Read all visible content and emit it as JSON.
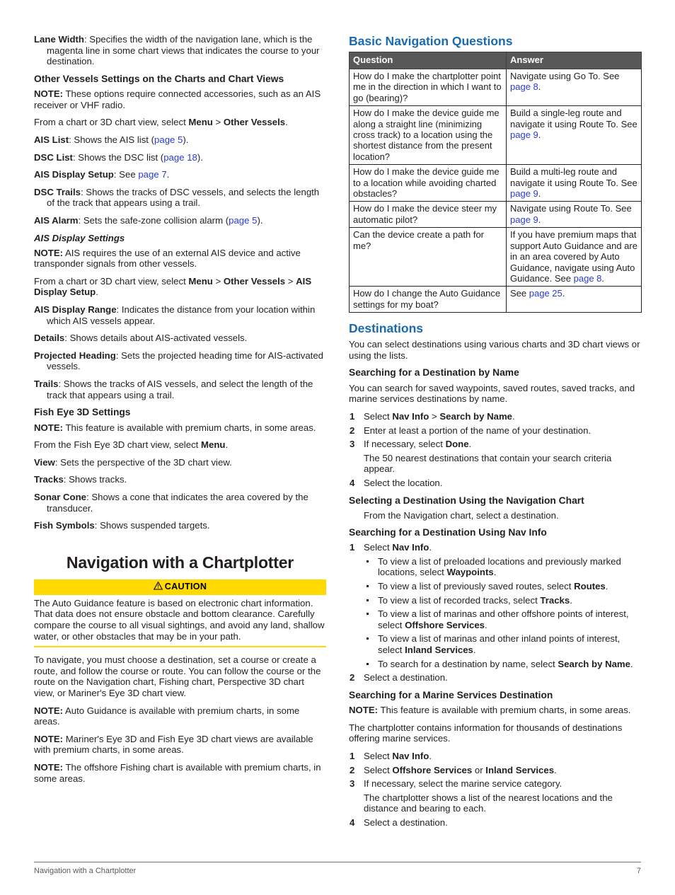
{
  "document": {
    "chapter_title": "Navigation with a Chartplotter",
    "footer_left": "Navigation with a Chartplotter",
    "footer_page": "7",
    "colors": {
      "heading_blue": "#1a6aae",
      "link_blue": "#2a3bd0",
      "caution_yellow": "#ffd900",
      "table_header_gray": "#585858",
      "body_text": "#231f20"
    }
  },
  "left_column": {
    "lane_width": {
      "term": "Lane Width",
      "text": ": Specifies the width of the navigation lane, which is the magenta line in some chart views that indicates the course to your destination."
    },
    "other_vessels": {
      "heading": "Other Vessels Settings on the Charts and Chart Views",
      "note_label": "NOTE:",
      "note_text": " These options require connected accessories, such as an AIS receiver or VHF radio.",
      "path_prefix": "From a chart or 3D chart view, select ",
      "path_menu": "Menu",
      "path_sep": " > ",
      "path_target": "Other Vessels",
      "path_period": ".",
      "items": [
        {
          "term": "AIS List",
          "text": ": Shows the AIS list (",
          "link": "page 5",
          "after": ")."
        },
        {
          "term": "DSC List",
          "text": ": Shows the DSC list (",
          "link": "page 18",
          "after": ")."
        },
        {
          "term": "AIS Display Setup",
          "text": ": See ",
          "link": "page 7",
          "after": "."
        },
        {
          "term": "DSC Trails",
          "text": ": Shows the tracks of DSC vessels, and selects the length of the track that appears using a trail.",
          "link": "",
          "after": ""
        },
        {
          "term": "AIS Alarm",
          "text": ": Sets the safe-zone collision alarm (",
          "link": "page 5",
          "after": ")."
        }
      ]
    },
    "ais_display_settings": {
      "heading": "AIS Display Settings",
      "note_label": "NOTE:",
      "note_text": " AIS requires the use of an external AIS device and active transponder signals from other vessels.",
      "path_prefix": "From a chart or 3D chart view, select ",
      "path_menu": "Menu",
      "path_sep1": " > ",
      "path_mid": "Other Vessels",
      "path_sep2": " > ",
      "path_target": "AIS Display Setup",
      "path_period": ".",
      "items": [
        {
          "term": "AIS Display Range",
          "text": ": Indicates the distance from your location within which AIS vessels appear."
        },
        {
          "term": "Details",
          "text": ": Shows details about AIS-activated vessels."
        },
        {
          "term": "Projected Heading",
          "text": ": Sets the projected heading time for AIS-activated vessels."
        },
        {
          "term": "Trails",
          "text": ": Shows the tracks of AIS vessels, and select the length of the track that appears using a trail."
        }
      ]
    },
    "fish_eye": {
      "heading": "Fish Eye 3D Settings",
      "note_label": "NOTE:",
      "note_text": " This feature is available with premium charts, in some areas.",
      "path_prefix": "From the Fish Eye 3D chart view, select ",
      "path_menu": "Menu",
      "path_period": ".",
      "items": [
        {
          "term": "View",
          "text": ": Sets the perspective of the 3D chart view."
        },
        {
          "term": "Tracks",
          "text": ": Shows tracks."
        },
        {
          "term": "Sonar Cone",
          "text": ": Shows a cone that indicates the area covered by the transducer."
        },
        {
          "term": "Fish Symbols",
          "text": ": Shows suspended targets."
        }
      ]
    },
    "caution": {
      "label": "CAUTION",
      "body": "The Auto Guidance feature is based on electronic chart information. That data does not ensure obstacle and bottom clearance. Carefully compare the course to all visual sightings, and avoid any land, shallow water, or other obstacles that may be in your path."
    },
    "nav_intro": {
      "paragraph": "To navigate, you must choose a destination, set a course or create a route, and follow the course or route. You can follow the course or the route on the Navigation chart, Fishing chart, Perspective 3D chart view, or Mariner's Eye 3D chart view.",
      "notes": [
        {
          "label": "NOTE:",
          "text": " Auto Guidance is available with premium charts, in some areas."
        },
        {
          "label": "NOTE:",
          "text": " Mariner's Eye 3D and Fish Eye 3D chart views are available with premium charts, in some areas."
        },
        {
          "label": "NOTE:",
          "text": " The offshore Fishing chart is available with premium charts, in some areas."
        }
      ]
    }
  },
  "right_column": {
    "basic_nav": {
      "heading": "Basic Navigation Questions",
      "table": {
        "headers": [
          "Question",
          "Answer"
        ],
        "rows": [
          {
            "question": "How do I make the chartplotter point me in the direction in which I want to go (bearing)?",
            "answer_pre": "Navigate using Go To. See ",
            "answer_link": "page 8",
            "answer_post": "."
          },
          {
            "question": "How do I make the device guide me along a straight line (minimizing cross track) to a location using the shortest distance from the present location?",
            "answer_pre": "Build a single-leg route and navigate it using Route To. See ",
            "answer_link": "page 9",
            "answer_post": "."
          },
          {
            "question": "How do I make the device guide me to a location while avoiding charted obstacles?",
            "answer_pre": "Build a multi-leg route and navigate it using Route To. See ",
            "answer_link": "page 9",
            "answer_post": "."
          },
          {
            "question": "How do I make the device steer my automatic pilot?",
            "answer_pre": "Navigate using Route To. See ",
            "answer_link": "page 9",
            "answer_post": "."
          },
          {
            "question": "Can the device create a path for me?",
            "answer_pre": "If you have premium maps that support Auto Guidance and are in an area covered by Auto Guidance, navigate using Auto Guidance. See ",
            "answer_link": "page 8",
            "answer_post": "."
          },
          {
            "question": "How do I change the Auto Guidance settings for my boat?",
            "answer_pre": "See ",
            "answer_link": "page 25",
            "answer_post": "."
          }
        ]
      }
    },
    "destinations": {
      "heading": "Destinations",
      "intro": "You can select destinations using various charts and 3D chart views or using the lists."
    },
    "search_by_name": {
      "heading": "Searching for a Destination by Name",
      "intro": "You can search for saved waypoints, saved routes, saved tracks, and marine services destinations by name.",
      "steps": [
        {
          "num": "1",
          "pre": "Select ",
          "bold1": "Nav Info",
          "mid": " > ",
          "bold2": "Search by Name",
          "post": "."
        },
        {
          "num": "2",
          "pre": "Enter at least a portion of the name of your destination.",
          "bold1": "",
          "mid": "",
          "bold2": "",
          "post": ""
        },
        {
          "num": "3",
          "pre": "If necessary, select ",
          "bold1": "Done",
          "mid": "",
          "bold2": "",
          "post": "."
        }
      ],
      "substep": "The 50 nearest destinations that contain your search criteria appear.",
      "step4": {
        "num": "4",
        "text": "Select the location."
      }
    },
    "select_nav_chart": {
      "heading": "Selecting a Destination Using the Navigation Chart",
      "body": "From the Navigation chart, select a destination."
    },
    "search_nav_info": {
      "heading": "Searching for a Destination Using Nav Info",
      "step1": {
        "num": "1",
        "pre": "Select ",
        "bold": "Nav Info",
        "post": "."
      },
      "bullets": [
        {
          "pre": "To view a list of preloaded locations and previously marked locations, select ",
          "bold": "Waypoints",
          "post": "."
        },
        {
          "pre": "To view a list of previously saved routes, select ",
          "bold": "Routes",
          "post": "."
        },
        {
          "pre": "To view a list of recorded tracks, select ",
          "bold": "Tracks",
          "post": "."
        },
        {
          "pre": "To view a list of marinas and other offshore points of interest, select ",
          "bold": "Offshore Services",
          "post": "."
        },
        {
          "pre": "To view a list of marinas and other inland points of interest, select ",
          "bold": "Inland Services",
          "post": "."
        },
        {
          "pre": "To search for a destination by name, select ",
          "bold": "Search by Name",
          "post": "."
        }
      ],
      "step2": {
        "num": "2",
        "text": "Select a destination."
      }
    },
    "marine_services": {
      "heading": "Searching for a Marine Services Destination",
      "note_label": "NOTE:",
      "note_text": " This feature is available with premium charts, in some areas.",
      "intro": "The chartplotter contains information for thousands of destinations offering marine services.",
      "steps": [
        {
          "num": "1",
          "pre": "Select ",
          "bold1": "Nav Info",
          "mid": "",
          "bold2": "",
          "post": "."
        },
        {
          "num": "2",
          "pre": "Select ",
          "bold1": "Offshore Services",
          "mid": " or ",
          "bold2": "Inland Services",
          "post": "."
        },
        {
          "num": "3",
          "pre": "If necessary, select the marine service category.",
          "bold1": "",
          "mid": "",
          "bold2": "",
          "post": ""
        }
      ],
      "substep": "The chartplotter shows a list of the nearest locations and the distance and bearing to each.",
      "step4": {
        "num": "4",
        "text": "Select a destination."
      }
    }
  }
}
